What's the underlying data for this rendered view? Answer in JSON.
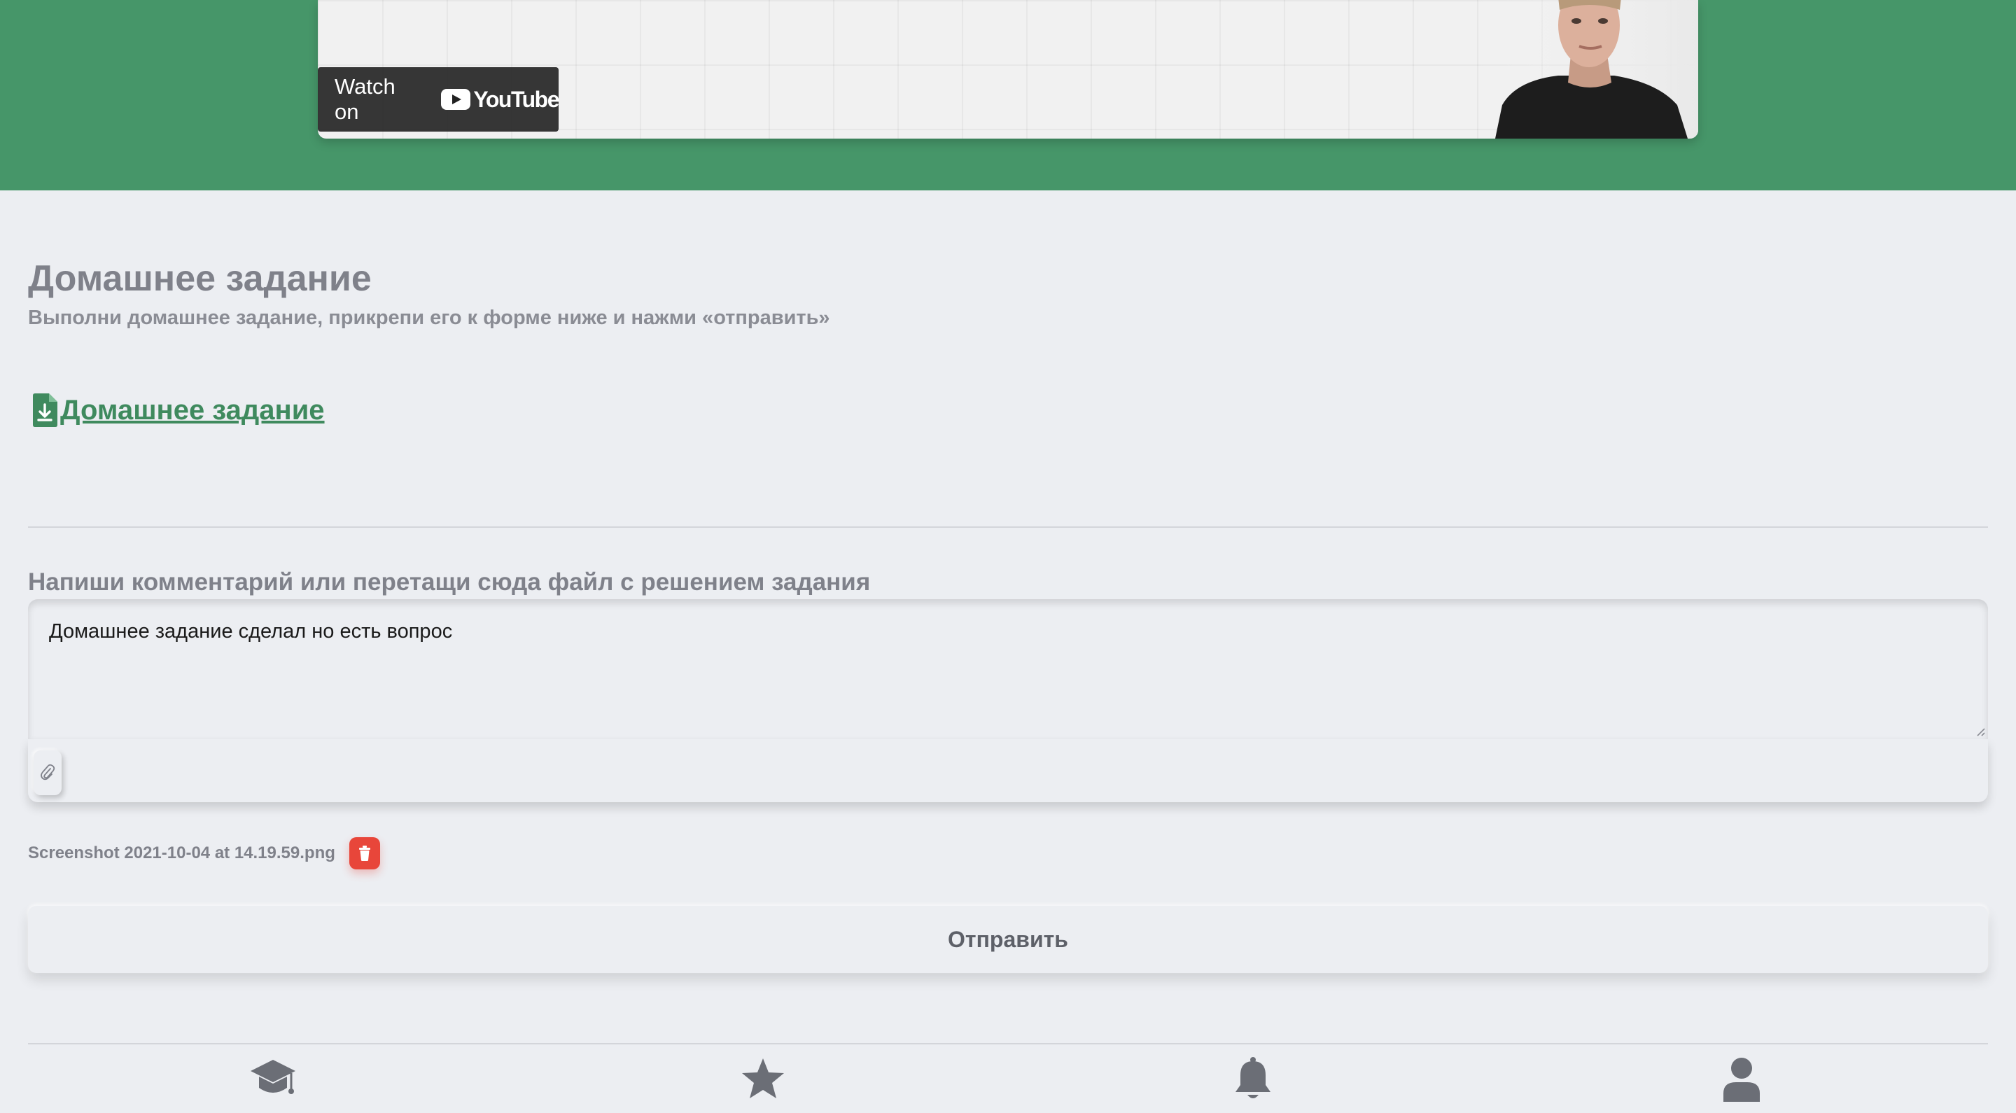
{
  "video": {
    "watch_on_label": "Watch on",
    "youtube_wordmark": "YouTube"
  },
  "homework": {
    "title": "Домашнее задание",
    "subtitle": "Выполни домашнее задание, прикрепи его к форме ниже и нажми «отправить»",
    "download_link_label": " Домашнее задание"
  },
  "comment": {
    "label": "Напиши комментарий или перетащи сюда файл с решением задания",
    "value": "Домашнее задание сделал но есть вопрос"
  },
  "attachment": {
    "file_name": "Screenshot 2021-10-04 at 14.19.59.png"
  },
  "submit": {
    "label": "Отправить"
  },
  "bottom_nav": {
    "items": [
      "graduation-cap-icon",
      "star-icon",
      "bell-icon",
      "user-icon"
    ]
  },
  "colors": {
    "accent_green": "#469669",
    "link_green": "#3f8a5e",
    "delete_red": "#e8463a",
    "background": "#eceef2"
  }
}
